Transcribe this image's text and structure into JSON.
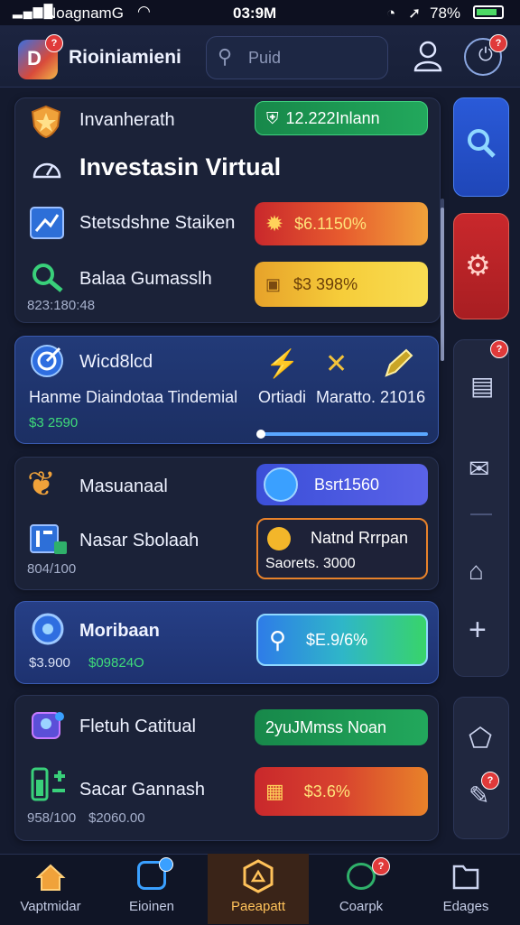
{
  "status_bar": {
    "carrier": "NoagnamG",
    "time": "03:9M",
    "battery": "78%"
  },
  "header": {
    "app_title": "Rioiniamieni",
    "search_placeholder": "Puid"
  },
  "cards": {
    "card1": {
      "row1_label": "Invanherath",
      "row1_value": "12.222Inlann",
      "heading": "Investasin Virtual",
      "row2_label": "Stetsdshne Staiken",
      "row2_value": "$6.1150%",
      "row3_label": "Balaa Gumasslh",
      "row3_value": "$3 398%",
      "footnote": "823:180:48"
    },
    "card2": {
      "title": "Wicd8lcd",
      "subtitle": "Hanme Diaindotaa Tindemial",
      "tag1": "Ortiadi",
      "tag2": "Maratto. 21016",
      "value": "$3 2590"
    },
    "card3": {
      "row1_label": "Masuanaal",
      "row1_value": "Bsrt1560",
      "row2_label": "Nasar Sbolaah",
      "box_title": "Natnd Rrrpan",
      "box_sub": "Saorets. 3000",
      "footnote": "804/100"
    },
    "card4": {
      "title": "Moribaan",
      "value1": "$3.900",
      "value2": "$09824O",
      "pill": "$E.9/6%"
    },
    "card5": {
      "row1_label": "Fletuh Catitual",
      "row1_value": "2yuJMmss Noan",
      "row2_label": "Sacar Gannash",
      "row2_value": "$3.6%",
      "foot1": "958/100",
      "foot2": "$2060.00"
    }
  },
  "bottom_nav": [
    {
      "label": "Vaptmidar",
      "icon": "home-icon"
    },
    {
      "label": "Eioinen",
      "icon": "portfolio-icon"
    },
    {
      "label": "Paeapatt",
      "icon": "hexagon-icon"
    },
    {
      "label": "Coarpk",
      "icon": "chat-icon"
    },
    {
      "label": "Edages",
      "icon": "folder-icon"
    }
  ],
  "colors": {
    "green": "#1fa35a",
    "red": "#d5382e",
    "yellow": "#f3c23a",
    "blue_accent": "#3a6fe0",
    "active_nav": "#ffc25a"
  }
}
